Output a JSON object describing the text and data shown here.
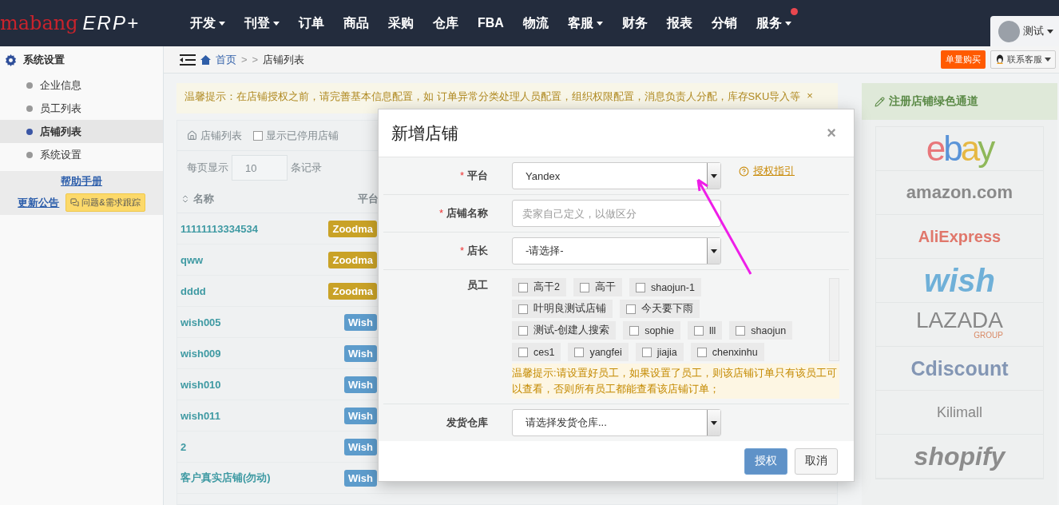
{
  "header": {
    "logo_brand": "mabang",
    "logo_product": "ERP+",
    "nav": [
      {
        "label": "开发",
        "dropdown": true,
        "badge": false
      },
      {
        "label": "刊登",
        "dropdown": true,
        "badge": false
      },
      {
        "label": "订单",
        "dropdown": false,
        "badge": false
      },
      {
        "label": "商品",
        "dropdown": false,
        "badge": false
      },
      {
        "label": "采购",
        "dropdown": false,
        "badge": false
      },
      {
        "label": "仓库",
        "dropdown": false,
        "badge": false
      },
      {
        "label": "FBA",
        "dropdown": false,
        "badge": false
      },
      {
        "label": "物流",
        "dropdown": false,
        "badge": false
      },
      {
        "label": "客服",
        "dropdown": true,
        "badge": false
      },
      {
        "label": "财务",
        "dropdown": false,
        "badge": false
      },
      {
        "label": "报表",
        "dropdown": false,
        "badge": false
      },
      {
        "label": "分销",
        "dropdown": false,
        "badge": false
      },
      {
        "label": "服务",
        "dropdown": true,
        "badge": true
      }
    ],
    "user": {
      "name": "测试"
    }
  },
  "breadcrumb": {
    "home": "首页",
    "separators": [
      ">",
      ">"
    ],
    "current": "店铺列表"
  },
  "top_actions": {
    "buy_button": "单量购买",
    "support_button": "联系客服"
  },
  "sidebar": {
    "title": "系统设置",
    "items": [
      {
        "label": "企业信息",
        "selected": false
      },
      {
        "label": "员工列表",
        "selected": false
      },
      {
        "label": "店铺列表",
        "selected": true
      },
      {
        "label": "系统设置",
        "selected": false
      }
    ],
    "help_link": "帮助手册",
    "news_link": "更新公告",
    "feedback_button": "问题&需求跟踪"
  },
  "tip": "温馨提示：在店铺授权之前，请完善基本信息配置，如 订单异常分类处理人员配置，组织权限配置，消息负责人分配，库存SKU导入等",
  "tip_close": "×",
  "store_panel": {
    "tab": "店铺列表",
    "show_disabled_label": "显示已停用店铺",
    "show_disabled_checked": false,
    "page_size_prefix": "每页显示",
    "page_size": "10",
    "page_size_suffix": "条记录",
    "columns": [
      "名称",
      "平台"
    ],
    "rows": [
      {
        "name": "11111113334534",
        "platform": "Zoodma",
        "color": "#c9a227"
      },
      {
        "name": "qww",
        "platform": "Zoodma",
        "color": "#c9a227"
      },
      {
        "name": "dddd",
        "platform": "Zoodma",
        "color": "#c9a227"
      },
      {
        "name": "wish005",
        "platform": "Wish",
        "color": "#5d9ccc"
      },
      {
        "name": "wish009",
        "platform": "Wish",
        "color": "#5d9ccc"
      },
      {
        "name": "wish010",
        "platform": "Wish",
        "color": "#5d9ccc"
      },
      {
        "name": "wish011",
        "platform": "Wish",
        "color": "#5d9ccc"
      },
      {
        "name": "2",
        "platform": "Wish",
        "color": "#5d9ccc"
      },
      {
        "name": "客户真实店铺(勿动)",
        "platform": "Wish",
        "color": "#5d9ccc"
      }
    ]
  },
  "register_panel": {
    "title": "注册店铺绿色通道",
    "logos": [
      {
        "text": "ebay",
        "kind": "ebay"
      },
      {
        "text": "amazon.com",
        "kind": "amazon"
      },
      {
        "text": "AliExpress",
        "kind": "aliexpress"
      },
      {
        "text": "wish",
        "kind": "wish"
      },
      {
        "text": "LAZADA",
        "kind": "lazada",
        "sub": "GROUP"
      },
      {
        "text": "Cdiscount",
        "kind": "cdiscount"
      },
      {
        "text": "Kilimall",
        "kind": "kilimall"
      },
      {
        "text": "shopify",
        "kind": "shopify"
      }
    ]
  },
  "modal": {
    "title": "新增店铺",
    "close": "×",
    "platform": {
      "label": "平台",
      "mark": "*",
      "value": "Yandex",
      "help_link": "授权指引"
    },
    "store_name": {
      "label": "店铺名称",
      "mark": "*",
      "placeholder": "卖家自己定义，以做区分"
    },
    "manager": {
      "label": "店长",
      "mark": "*",
      "value": "-请选择-"
    },
    "staff": {
      "label": "员工",
      "option_rows": [
        [
          {
            "label": "高干2",
            "checked": false
          },
          {
            "label": "高干",
            "checked": false
          },
          {
            "label": "shaojun-1",
            "checked": false
          }
        ],
        [
          {
            "label": "叶明良测试店铺",
            "checked": false
          },
          {
            "label": "今天要下雨",
            "checked": false
          }
        ],
        [
          {
            "label": "测试-创建人搜索",
            "checked": false
          },
          {
            "label": "sophie",
            "checked": false
          },
          {
            "label": "lll",
            "checked": false
          },
          {
            "label": "shaojun",
            "checked": false
          }
        ],
        [
          {
            "label": "ces1",
            "checked": false
          },
          {
            "label": "yangfei",
            "checked": false
          },
          {
            "label": "jiajia",
            "checked": false
          },
          {
            "label": "chenxinhu",
            "checked": false
          }
        ]
      ],
      "note": "温馨提示:请设置好员工，如果设置了员工，则该店铺订单只有该员工可以查看，否则所有员工都能查看该店铺订单；"
    },
    "warehouse": {
      "label": "发货仓库",
      "value": "请选择发货仓库..."
    },
    "buttons": [
      {
        "label": "授权",
        "kind": "primary"
      },
      {
        "label": "取消",
        "kind": "default"
      }
    ]
  }
}
